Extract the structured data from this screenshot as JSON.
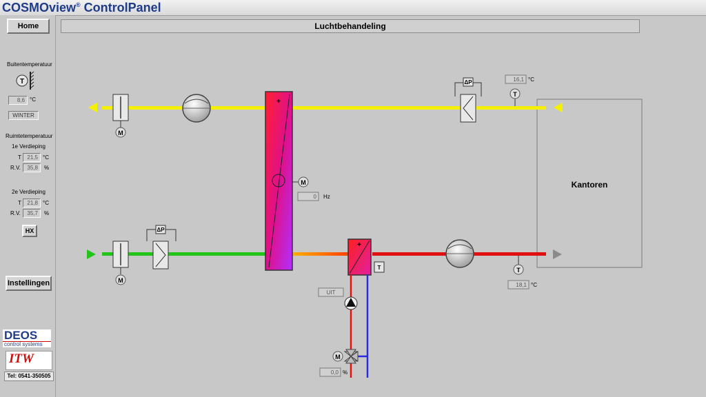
{
  "app": {
    "title": "COSMOview",
    "reg": "®",
    "title_suffix": " ControlPanel"
  },
  "header": {
    "title": "Luchtbehandeling"
  },
  "sidebar": {
    "home_label": "Home",
    "outside_temp_label": "Buitentemperatuur",
    "outside_temp_value": "8,6",
    "outside_temp_unit": "°C",
    "season": "WINTER",
    "room_temp_label": "Ruimtetemperatuur",
    "floor1": {
      "label": "1e Verdieping",
      "t_label": "T",
      "t_value": "21,5",
      "t_unit": "°C",
      "rv_label": "R.V.",
      "rv_value": "35,8",
      "rv_unit": "%"
    },
    "floor2": {
      "label": "2e Verdieping",
      "t_label": "T",
      "t_value": "21,8",
      "t_unit": "°C",
      "rv_label": "R.V.",
      "rv_value": "35,7",
      "rv_unit": "%"
    },
    "hx_label": "HX",
    "settings_label": "Instellingen",
    "deos_logo": "DEOS",
    "deos_sub": "control systems",
    "itw_logo": "ITW",
    "phone": "Tel: 0541-350505"
  },
  "diagram": {
    "zone_label": "Kantoren",
    "exhaust_temp_value": "16,1",
    "exhaust_temp_unit": "°C",
    "supply_temp_value": "18,1",
    "supply_temp_unit": "°C",
    "hx_freq_value": "0",
    "hx_freq_unit": "Hz",
    "pump_status": "UIT",
    "valve_value": "0,0",
    "valve_unit": "%",
    "motor_label": "M",
    "temp_sensor_label": "T",
    "dp_label": "ΔP",
    "plus_label": "+",
    "colors": {
      "exhaust": "#f5f000",
      "supply_in": "#22c41a",
      "supply_out": "#e01010",
      "heater_flow": "#ff5a00",
      "return": "#2a2ae0"
    }
  }
}
